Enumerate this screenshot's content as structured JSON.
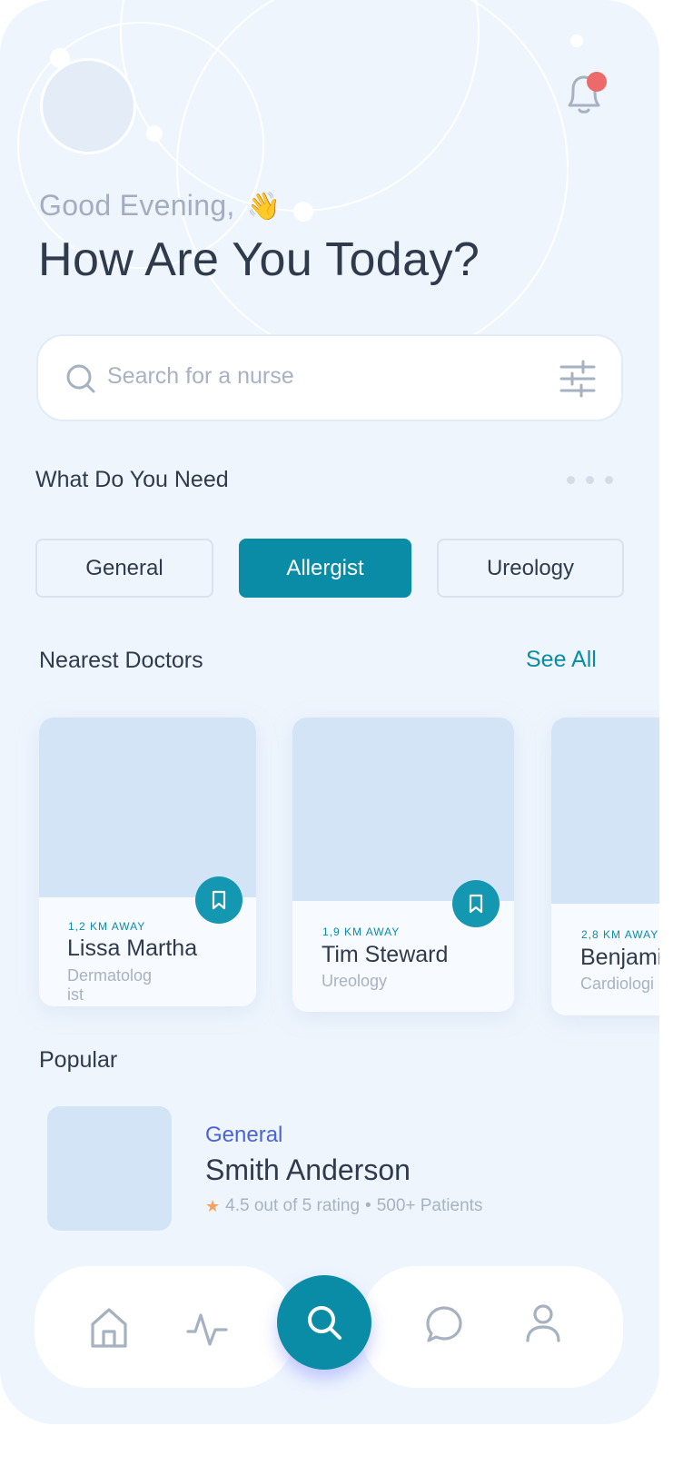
{
  "header": {
    "greeting": "Good Evening,",
    "greeting_emoji": "👋",
    "headline": "How Are You Today?"
  },
  "search": {
    "placeholder": "Search for a nurse"
  },
  "needs": {
    "title": "What Do You Need",
    "categories": [
      "General",
      "Allergist",
      "Ureology"
    ],
    "active_category": "Allergist"
  },
  "nearest": {
    "title": "Nearest Doctors",
    "see_all": "See All",
    "doctors": [
      {
        "distance": "1,2 KM AWAY",
        "name": "Lissa Martha",
        "specialty": "Dermatolog ist"
      },
      {
        "distance": "1,9 KM AWAY",
        "name": "Tim Steward",
        "specialty": "Ureology"
      },
      {
        "distance": "2,8 KM AWAY",
        "name": "Benjami",
        "specialty": "Cardiologi"
      }
    ]
  },
  "popular": {
    "title": "Popular",
    "items": [
      {
        "category": "General",
        "name": "Smith Anderson",
        "rating_text": "4.5 out of 5 rating",
        "separator": "•",
        "patients": "500+ Patients"
      }
    ]
  },
  "nav": {
    "items": [
      "home-icon",
      "activity-icon",
      "search-icon",
      "chat-icon",
      "profile-icon"
    ],
    "active": "search-icon"
  },
  "colors": {
    "accent": "#0a8ca7",
    "background": "#eef5fd",
    "notification_dot": "#ec6a6a",
    "popular_category": "#4a63d9"
  }
}
